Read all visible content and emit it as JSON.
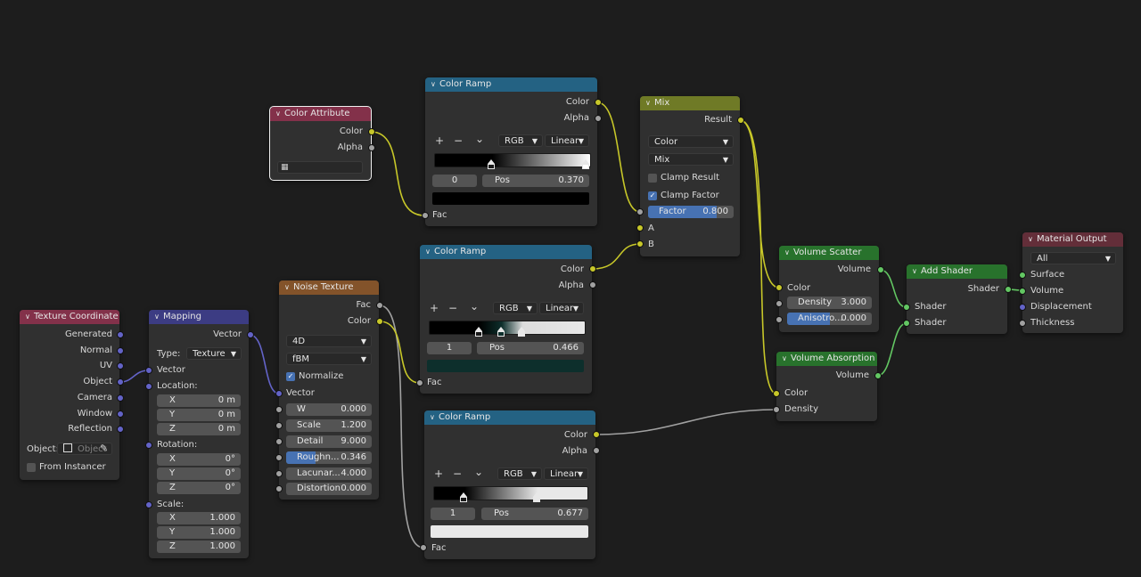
{
  "nodes": {
    "texture_coordinate": {
      "title": "Texture Coordinate",
      "outputs": [
        "Generated",
        "Normal",
        "UV",
        "Object",
        "Camera",
        "Window",
        "Reflection"
      ],
      "object_label": "Object:",
      "object_placeholder": "Object",
      "from_instancer": "From Instancer"
    },
    "mapping": {
      "title": "Mapping",
      "output": "Vector",
      "type_label": "Type:",
      "type_value": "Texture",
      "input_vector": "Vector",
      "location_label": "Location:",
      "location": [
        {
          "axis": "X",
          "value": "0 m"
        },
        {
          "axis": "Y",
          "value": "0 m"
        },
        {
          "axis": "Z",
          "value": "0 m"
        }
      ],
      "rotation_label": "Rotation:",
      "rotation": [
        {
          "axis": "X",
          "value": "0°"
        },
        {
          "axis": "Y",
          "value": "0°"
        },
        {
          "axis": "Z",
          "value": "0°"
        }
      ],
      "scale_label": "Scale:",
      "scale": [
        {
          "axis": "X",
          "value": "1.000"
        },
        {
          "axis": "Y",
          "value": "1.000"
        },
        {
          "axis": "Z",
          "value": "1.000"
        }
      ]
    },
    "color_attribute": {
      "title": "Color Attribute",
      "outputs": [
        "Color",
        "Alpha"
      ]
    },
    "noise_texture": {
      "title": "Noise Texture",
      "outputs": [
        "Fac",
        "Color"
      ],
      "dimensions": "4D",
      "type": "fBM",
      "normalize": "Normalize",
      "input_vector": "Vector",
      "fields": [
        {
          "label": "W",
          "value": "0.000",
          "fill": 0
        },
        {
          "label": "Scale",
          "value": "1.200",
          "fill": 0
        },
        {
          "label": "Detail",
          "value": "9.000",
          "fill": 0
        },
        {
          "label": "Roughn...",
          "value": "0.346",
          "fill": 0.346
        },
        {
          "label": "Lacunar...",
          "value": "4.000",
          "fill": 0
        },
        {
          "label": "Distortion",
          "value": "0.000",
          "fill": 0
        }
      ]
    },
    "color_ramp_1": {
      "title": "Color Ramp",
      "outputs": [
        "Color",
        "Alpha"
      ],
      "plus": "+",
      "minus": "−",
      "chev": "⌄",
      "mode": "RGB",
      "interp": "Linear",
      "index": "0",
      "pos_label": "Pos",
      "pos_value": "0.370",
      "input": "Fac",
      "stops": [
        0.37,
        1.0
      ],
      "active_color": "#000000"
    },
    "color_ramp_2": {
      "title": "Color Ramp",
      "outputs": [
        "Color",
        "Alpha"
      ],
      "plus": "+",
      "minus": "−",
      "chev": "⌄",
      "mode": "RGB",
      "interp": "Linear",
      "index": "1",
      "pos_label": "Pos",
      "pos_value": "0.466",
      "input": "Fac",
      "stops": [
        0.32,
        0.466,
        0.6
      ],
      "active_color": "#0d2f2c"
    },
    "color_ramp_3": {
      "title": "Color Ramp",
      "outputs": [
        "Color",
        "Alpha"
      ],
      "plus": "+",
      "minus": "−",
      "chev": "⌄",
      "mode": "RGB",
      "interp": "Linear",
      "index": "1",
      "pos_label": "Pos",
      "pos_value": "0.677",
      "input": "Fac",
      "stops": [
        0.2,
        0.677
      ],
      "active_color": "#e8e8e8"
    },
    "mix": {
      "title": "Mix",
      "output": "Result",
      "data_type": "Color",
      "blend": "Mix",
      "clamp_result": "Clamp Result",
      "clamp_factor": "Clamp Factor",
      "factor_label": "Factor",
      "factor_value": "0.800",
      "factor": 0.8,
      "inputs": [
        "A",
        "B"
      ]
    },
    "volume_scatter": {
      "title": "Volume Scatter",
      "output": "Volume",
      "input_color": "Color",
      "density_label": "Density",
      "density_value": "3.000",
      "aniso_label": "Anisotro...",
      "aniso_value": "0.000",
      "aniso_fill": 0.5
    },
    "volume_absorption": {
      "title": "Volume Absorption",
      "output": "Volume",
      "inputs": [
        "Color",
        "Density"
      ]
    },
    "add_shader": {
      "title": "Add Shader",
      "output": "Shader",
      "inputs": [
        "Shader",
        "Shader"
      ]
    },
    "material_output": {
      "title": "Material Output",
      "target": "All",
      "inputs": [
        "Surface",
        "Volume",
        "Displacement",
        "Thickness"
      ]
    }
  },
  "colors": {
    "background": "#1d1d1d",
    "node_body": "#303030",
    "header_input": "#83314a",
    "header_vector": "#3c3c83",
    "header_texture": "#83532a",
    "header_converter": "#246283",
    "header_mix": "#6f7a26",
    "header_shader": "#28722c",
    "header_output": "#632e39",
    "socket_color": "#c7c729",
    "socket_float": "#a1a1a1",
    "socket_vector": "#6363c7",
    "socket_shader": "#63c763"
  }
}
